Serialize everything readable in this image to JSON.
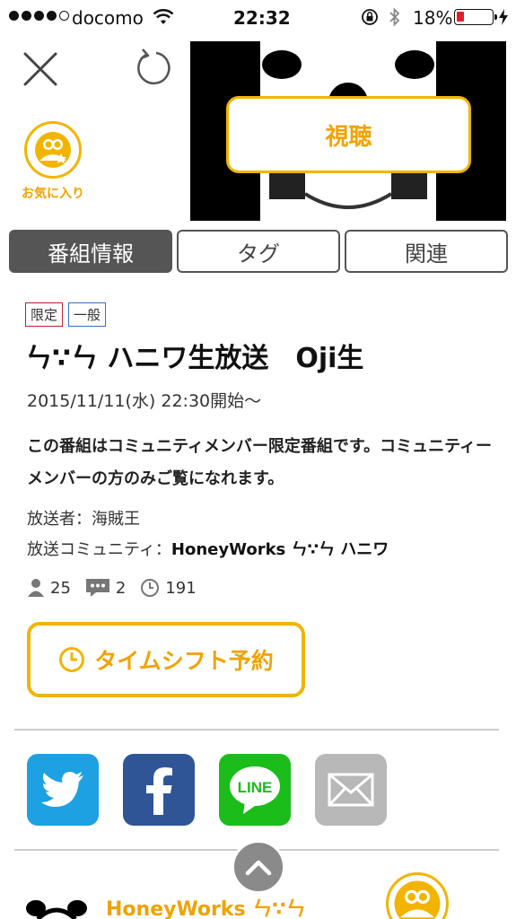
{
  "status_bar": {
    "carrier": "docomo",
    "time": "22:32",
    "battery": "18%",
    "battery_level": 0.18,
    "signal_bars": 4
  },
  "header": {
    "favorite_label": "お気に入り",
    "watch_label": "視聴"
  },
  "tabs": [
    {
      "label": "番組情報",
      "active": true
    },
    {
      "label": "タグ",
      "active": false
    },
    {
      "label": "関連",
      "active": false
    }
  ],
  "program": {
    "tags": [
      "限定",
      "一般"
    ],
    "title": "ㄣ∵ㄣ ハニワ生放送　Oji生",
    "datetime": "2015/11/11(水) 22:30開始〜",
    "description": "この番組はコミュニティメンバー限定番組です。コミュニティーメンバーの方のみご覧になれます。",
    "broadcaster_label": "放送者：",
    "broadcaster": "海賊王",
    "community_label": "放送コミュニティ：",
    "community": "HoneyWorks ㄣ∵ㄣ ハニワ",
    "viewers": "25",
    "comments": "2",
    "timeshifts": "191",
    "timeshift_button": "タイムシフト予約"
  },
  "share": [
    {
      "name": "twitter",
      "color": "#1da1e2"
    },
    {
      "name": "facebook",
      "color": "#2f5597"
    },
    {
      "name": "line",
      "color": "#1bbd1b",
      "text": "LINE"
    },
    {
      "name": "mail",
      "color": "#b8b8b8"
    }
  ],
  "bottom": {
    "community_name": "HoneyWorks ㄣ∵ㄣ"
  },
  "colors": {
    "accent": "#f2b400",
    "tab_active": "#555555",
    "tag_limited": "#c0202a",
    "tag_general": "#3370c8"
  },
  "icons": [
    "close-icon",
    "reload-icon",
    "favorite-icon",
    "viewers-icon",
    "comments-icon",
    "clock-icon",
    "chevron-up-icon"
  ]
}
